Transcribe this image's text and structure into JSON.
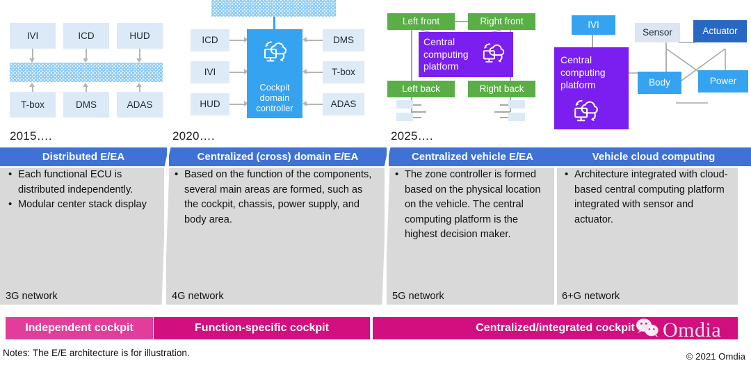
{
  "slide": {
    "notes": "Notes: The E/E architecture is for illustration.",
    "copyright": "© 2021 Omdia",
    "watermark_brand": "Omdia",
    "watermark_icon": "wechat-icon"
  },
  "timeline": {
    "years": [
      "2015….",
      "2020….",
      "2025…."
    ]
  },
  "columns": [
    {
      "header": "Distributed E/EA",
      "bullets": [
        "Each functional ECU is distributed independently.",
        "Modular center stack display"
      ],
      "network": "3G network"
    },
    {
      "header": "Centralized (cross) domain E/EA",
      "bullets": [
        "Based on the function of the components, several main areas are formed, such as the cockpit, chassis, power supply, and body area."
      ],
      "network": "4G network"
    },
    {
      "header": "Centralized vehicle E/EA",
      "bullets": [
        "The zone controller is formed based on the physical location on the vehicle. The central computing platform is the highest decision maker."
      ],
      "network": "5G network"
    },
    {
      "header": "Vehicle cloud computing",
      "bullets": [
        "Architecture integrated with cloud-based central computing platform integrated with sensor and actuator."
      ],
      "network": "6+G network"
    }
  ],
  "cockpit_bars": [
    {
      "label": "Independent cockpit",
      "color": "#e23d9a"
    },
    {
      "label": "Function-specific cockpit",
      "color": "#d10f7e"
    },
    {
      "label": "Centralized/integrated cockpit",
      "color": "#d10f7e"
    }
  ],
  "diagram_2015": {
    "top_nodes": [
      "IVI",
      "ICD",
      "HUD"
    ],
    "bottom_nodes": [
      "T-box",
      "DMS",
      "ADAS"
    ],
    "bus_label": "",
    "bus_style": "dotted-bus"
  },
  "diagram_2020": {
    "left_nodes": [
      "ICD",
      "IVI",
      "HUD"
    ],
    "right_nodes": [
      "DMS",
      "T-box",
      "ADAS"
    ],
    "center": "Cockpit domain controller",
    "center_icon": "cloud-computing-icon",
    "cloud_bus_style": "dotted-bus"
  },
  "diagram_2025": {
    "zones": [
      "Left front",
      "Right front",
      "Left back",
      "Right back"
    ],
    "center": "Central computing platform",
    "center_icon": "cloud-computing-icon"
  },
  "diagram_cloud": {
    "ivi": "IVI",
    "center": "Central computing platform",
    "center_icon": "cloud-computing-icon",
    "nodes": [
      "Sensor",
      "Actuator",
      "Body",
      "Power"
    ]
  },
  "colors": {
    "header_blue": "#3f72d4",
    "panel_gray": "#d9d9d9",
    "accent_purple": "#7a1ff0",
    "accent_green": "#5aae46",
    "accent_blue": "#35a3f0",
    "pink_light": "#e23d9a",
    "pink_dark": "#d10f7e"
  }
}
